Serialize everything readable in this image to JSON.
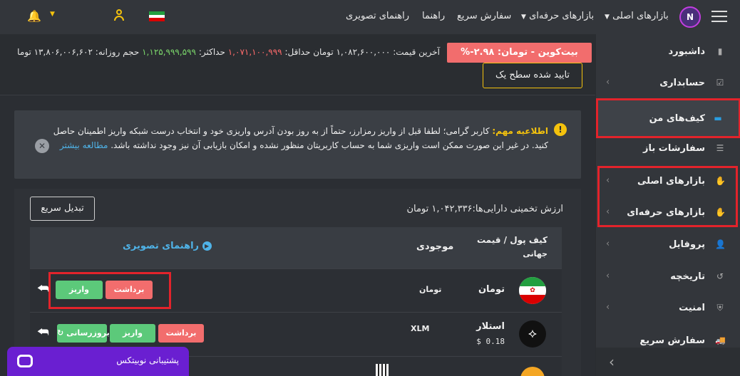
{
  "navbar": {
    "menu_items": [
      "بازارهای اصلی",
      "بازارهای حرفه‌ای",
      "سفارش سریع",
      "راهنما",
      "راهنمای تصویری"
    ]
  },
  "ticker": {
    "market_badge": "بیت‌کوین - تومان: ۲.۹۸-%",
    "last_price_label": "آخرین قیمت:",
    "last_price_value": "۱,۰۸۲,۶۰۰,۰۰۰ تومان",
    "min_label": "حداقل:",
    "min_value": "۱,۰۷۱,۱۰۰,۹۹۹",
    "max_label": "حداکثر:",
    "max_value": "۱,۱۲۵,۹۹۹,۵۹۹",
    "volume_label": "حجم روزانه:",
    "volume_value": "۱۳,۸۰۶,۰۰۶,۶۰۲ توما",
    "level_badge": "تایید شده سطح یک"
  },
  "sidebar": {
    "items": [
      {
        "label": "داشبورد"
      },
      {
        "label": "حسابداری"
      },
      {
        "label": "کیف‌های من"
      },
      {
        "label": "سفارشات باز"
      },
      {
        "label": "بازارهای اصلی"
      },
      {
        "label": "بازارهای حرفه‌ای"
      },
      {
        "label": "پروفایل"
      },
      {
        "label": "تاریخچه"
      },
      {
        "label": "امنیت"
      },
      {
        "label": "سفارش سریع"
      }
    ]
  },
  "alert": {
    "title": "اطلاعیه مهم:",
    "line1": "کاربر گرامی؛ لطفا قبل از واریز رمزارز، حتماً از به روز بودن آدرس واریزی خود و انتخاب درست شبکه واریز اطمینان",
    "line2": "حاصل کنید. در غیر این صورت ممکن است واریزی شما به حساب کاربریتان منظور نشده و امکان بازیابی آن نیز وجود نداشته",
    "line3": "باشد.",
    "more_link": "مطالعه بیشتر"
  },
  "wallet": {
    "estimate_text": "ارزش تخمینی دارایی‌ها:۱,۰۴۲,۳۳۶ تومان",
    "quick_swap": "تبدیل سریع",
    "col_wallet": "کیف پول / قیمت",
    "col_wallet2": "جهانی",
    "col_balance": "موجودی",
    "visual_guide": "راهنمای تصویری",
    "rows": [
      {
        "name": "تومان",
        "symbol": "تومان",
        "price": "",
        "withdraw": "برداشت",
        "deposit": "واریز"
      },
      {
        "name": "استلار",
        "symbol": "XLM",
        "price": "$ 0.18",
        "withdraw": "برداشت",
        "deposit": "واریز",
        "update": "بروزرسانی"
      }
    ]
  },
  "support": {
    "label": "پشتیبانی نوبیتکس"
  },
  "colors": {
    "accent_red": "#e3232b",
    "badge_red": "#f26d6d",
    "badge_green": "#5cc97a",
    "link_blue": "#4fb3e8",
    "warning_yellow": "#f4c20d",
    "support_purple": "#6a1fd1"
  }
}
